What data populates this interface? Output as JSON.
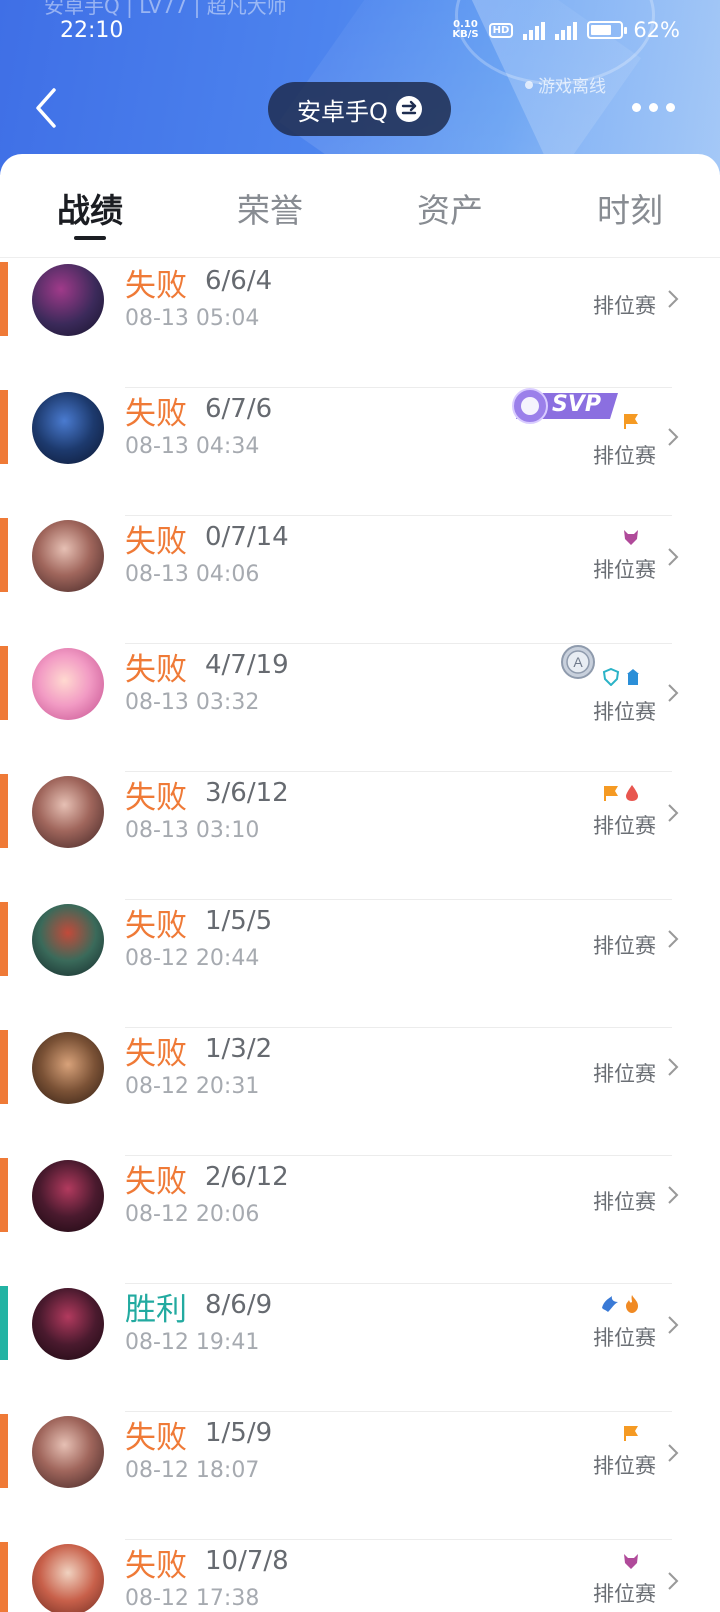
{
  "status_bar": {
    "time": "22:10",
    "net_speed": "0.10",
    "net_unit": "KB/S",
    "hd": "HD",
    "battery": "62%",
    "faded_title": "安卓手Q | LV77 | 超凡大师"
  },
  "header": {
    "title": "安卓手Q",
    "offline_text": "游戏离线"
  },
  "tabs": [
    {
      "label": "战绩"
    },
    {
      "label": "荣誉"
    },
    {
      "label": "资产"
    },
    {
      "label": "时刻"
    }
  ],
  "matches": [
    {
      "result": "失败",
      "kda": "6/6/4",
      "time": "08-13 05:04",
      "mode": "排位赛",
      "outcome": "loss",
      "champion_color": "#3b2a5a"
    },
    {
      "result": "失败",
      "kda": "6/7/6",
      "time": "08-13 04:34",
      "mode": "排位赛",
      "outcome": "loss",
      "champion_color": "#1d3a6e",
      "svp": "SVP"
    },
    {
      "result": "失败",
      "kda": "0/7/14",
      "time": "08-13 04:06",
      "mode": "排位赛",
      "outcome": "loss",
      "champion_color": "#7a4a44"
    },
    {
      "result": "失败",
      "kda": "4/7/19",
      "time": "08-13 03:32",
      "mode": "排位赛",
      "outcome": "loss",
      "champion_color": "#e98fb7"
    },
    {
      "result": "失败",
      "kda": "3/6/12",
      "time": "08-13 03:10",
      "mode": "排位赛",
      "outcome": "loss",
      "champion_color": "#7a4a44"
    },
    {
      "result": "失败",
      "kda": "1/5/5",
      "time": "08-12 20:44",
      "mode": "排位赛",
      "outcome": "loss",
      "champion_color": "#3a6a5a"
    },
    {
      "result": "失败",
      "kda": "1/3/2",
      "time": "08-12 20:31",
      "mode": "排位赛",
      "outcome": "loss",
      "champion_color": "#7b5236"
    },
    {
      "result": "失败",
      "kda": "2/6/12",
      "time": "08-12 20:06",
      "mode": "排位赛",
      "outcome": "loss",
      "champion_color": "#4a1a2e"
    },
    {
      "result": "胜利",
      "kda": "8/6/9",
      "time": "08-12 19:41",
      "mode": "排位赛",
      "outcome": "win",
      "champion_color": "#4a1a2e"
    },
    {
      "result": "失败",
      "kda": "1/5/9",
      "time": "08-12 18:07",
      "mode": "排位赛",
      "outcome": "loss",
      "champion_color": "#7a4a44"
    },
    {
      "result": "失败",
      "kda": "10/7/8",
      "time": "08-12 17:38",
      "mode": "排位赛",
      "outcome": "loss",
      "champion_color": "#c8604a"
    }
  ],
  "colors": {
    "loss": "#ef7a37",
    "win": "#22aaa0",
    "header_blue": "#4d84ee"
  }
}
